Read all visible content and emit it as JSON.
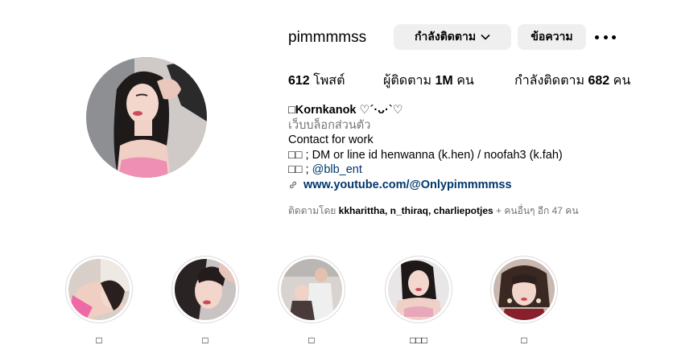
{
  "profile": {
    "username": "pimmmmss",
    "following_button_label": "กำลังติดตาม",
    "message_button_label": "ข้อความ",
    "more_options_icon": "more-horizontal-icon"
  },
  "stats": {
    "posts_count": "612",
    "posts_label": "โพสต์",
    "followers_label": "ผู้ติดตาม",
    "followers_count": "1M",
    "followers_unit": "คน",
    "following_label": "กำลังติดตาม",
    "following_count": "682",
    "following_unit": "คน"
  },
  "bio": {
    "name": "□Kornkanok ♡´·ᴗ·`♡",
    "category": "เว็บบล็อกส่วนตัว",
    "line1": "Contact for work",
    "line2": "□□ ; DM or line id henwanna (k.hen) / noofah3 (k.fah)",
    "line3_prefix": "□□ ; ",
    "line3_mention": "@blb_ent",
    "link": "www.youtube.com/@Onlypimmmmss"
  },
  "followed_by": {
    "prefix": "ติดตามโดย ",
    "names": "kkharittha, n_thiraq, charliepotjes",
    "suffix": " + คนอื่นๆ อีก 47 คน"
  },
  "highlights": [
    {
      "label": "□"
    },
    {
      "label": "□"
    },
    {
      "label": "□"
    },
    {
      "label": "□□□"
    },
    {
      "label": "□"
    }
  ],
  "colors": {
    "button_bg": "#efefef",
    "secondary_text": "#737373",
    "link_text": "#00376b",
    "highlight_ring": "#dbdbdb"
  }
}
